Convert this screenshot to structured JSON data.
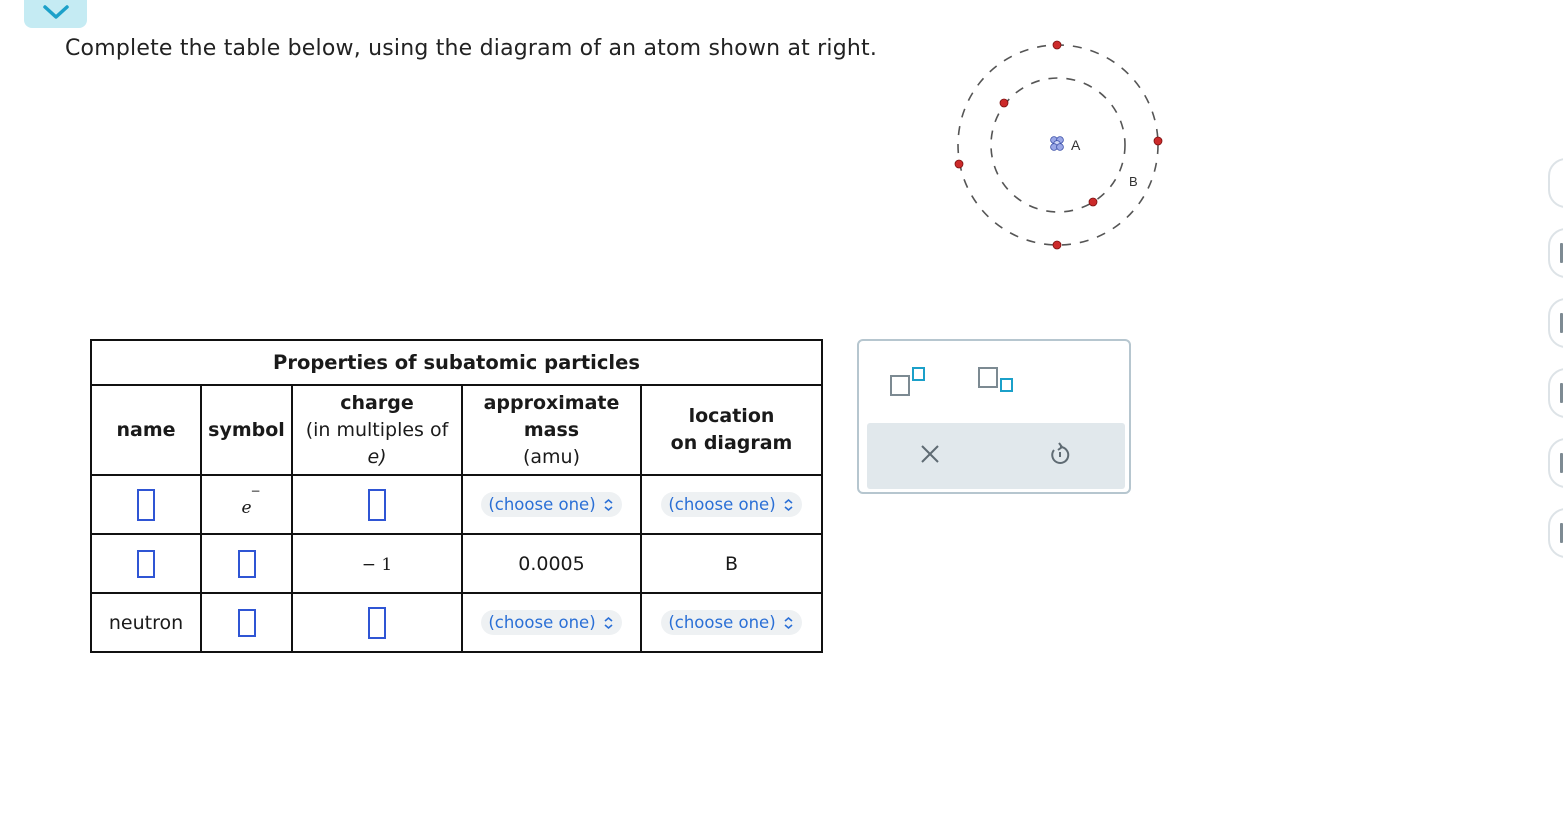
{
  "instruction": "Complete the table below, using the diagram of an atom shown at right.",
  "atom_diagram": {
    "labels": {
      "nucleus": "A",
      "outer_electron": "B"
    },
    "electron_color": "#cc2a2a"
  },
  "table": {
    "caption": "Properties of subatomic particles",
    "headers": {
      "name": "name",
      "symbol": "symbol",
      "charge_line1": "charge",
      "charge_line2": "(in multiples of",
      "charge_line3": "e)",
      "mass_line1": "approximate",
      "mass_line2": "mass",
      "mass_line3": "(amu)",
      "location_line1": "location",
      "location_line2": "on diagram"
    },
    "rows": [
      {
        "name": "",
        "symbol": "e",
        "symbol_superscript": "−",
        "charge": "",
        "mass": "(choose one)",
        "location": "(choose one)"
      },
      {
        "name": "",
        "symbol": "",
        "charge": "− 1",
        "mass": "0.0005",
        "location": "B"
      },
      {
        "name": "neutron",
        "symbol": "",
        "charge": "",
        "mass": "(choose one)",
        "location": "(choose one)"
      }
    ]
  },
  "tool_panel": {
    "superscript_icon": "superscript-icon",
    "subscript_icon": "subscript-icon",
    "clear_icon": "close-icon",
    "undo_icon": "undo-icon",
    "clear_glyph": "×"
  },
  "colors": {
    "accent_blue": "#2f55d4",
    "link_blue": "#2a6fd6",
    "tab_bg": "#c5ebf3",
    "tool_teal": "#1ba0c9"
  }
}
